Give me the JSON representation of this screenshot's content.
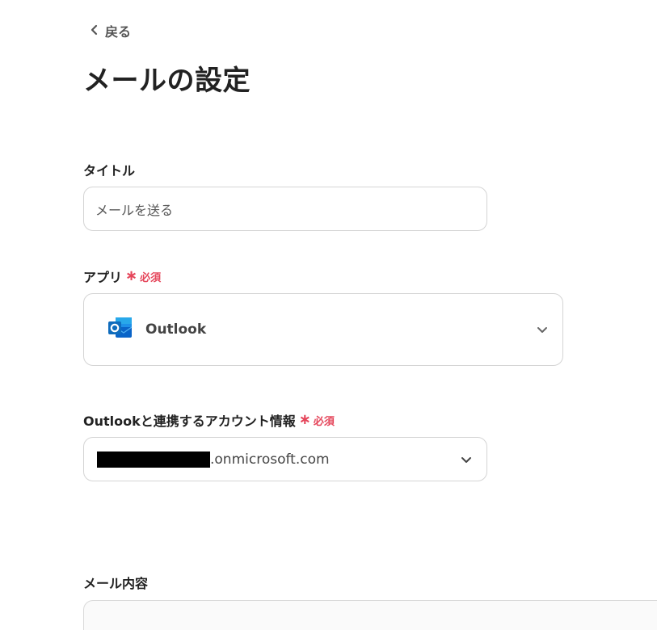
{
  "header": {
    "back_label": "戻る",
    "page_title": "メールの設定"
  },
  "fields": {
    "title": {
      "label": "タイトル",
      "value": "メールを送る"
    },
    "app": {
      "label": "アプリ",
      "required": "必須",
      "selected": "Outlook",
      "icon": "outlook-icon"
    },
    "account": {
      "label": "Outlookと連携するアカウント情報",
      "required": "必須",
      "value_suffix": ".onmicrosoft.com"
    },
    "content": {
      "label": "メール内容"
    }
  },
  "colors": {
    "required": "#e5455a",
    "outlook_blue": "#0a64c8"
  }
}
